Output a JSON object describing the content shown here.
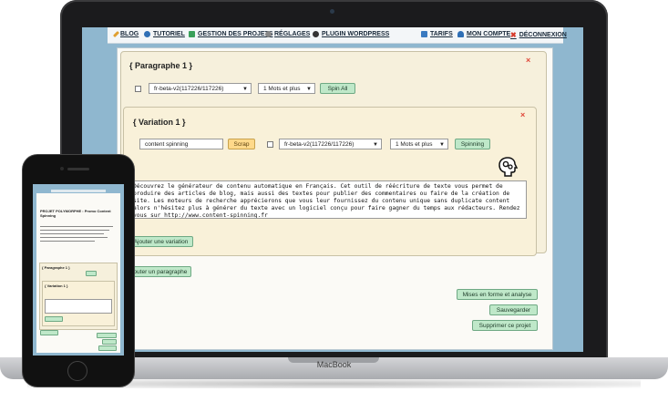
{
  "device": {
    "brand": "MacBook"
  },
  "nav": {
    "items": [
      {
        "label": "BLOG",
        "icon": "pencil-icon",
        "color": "#e0a030"
      },
      {
        "label": "TUTORIEL",
        "icon": "info-icon",
        "color": "#2f6fb5"
      },
      {
        "label": "GESTION DES PROJETS",
        "icon": "plus-icon",
        "color": "#3aa05a"
      },
      {
        "label": "RÉGLAGES",
        "icon": "gear-icon",
        "color": "#666666"
      },
      {
        "label": "PLUGIN WORDPRESS",
        "icon": "wordpress-icon",
        "color": "#333333"
      },
      {
        "label": "TARIFS",
        "icon": "list-icon",
        "color": "#3a7ac0"
      },
      {
        "label": "MON COMPTE",
        "icon": "user-icon",
        "color": "#2f6fb5"
      },
      {
        "label": "DÉCONNEXION",
        "icon": "close-icon",
        "color": "#d63b2c"
      }
    ]
  },
  "paragraph": {
    "title": "{ Paragraphe 1 }",
    "close": "×",
    "language_select": "fr-beta-v2(117226/117226)",
    "words_select": "1 Mots et plus",
    "spin_all_label": "Spin All"
  },
  "variation": {
    "title": "{ Variation 1 }",
    "close": "×",
    "keyword_value": "content spinning",
    "scrap_label": "Scrap",
    "language_select": "fr-beta-v2(117226/117226)",
    "words_select": "1 Mots et plus",
    "spinning_label": "Spinning",
    "text": "Découvrez le générateur de contenu automatique en Français. Cet outil de réécriture de texte vous permet de produire des articles de blog, mais aussi des textes pour publier des commentaires ou faire de la création de site. Les moteurs de recherche apprécierons que vous leur fournissez du contenu unique sans duplicate content alors n'hésitez plus à générer du texte avec un logiciel conçu pour faire gagner du temps aux rédacteurs. Rendez vous sur http://www.content-spinning.fr"
  },
  "actions": {
    "add_variation": "Ajouter une variation",
    "add_paragraph": "Ajouter un paragraphe",
    "format_analyze": "Mises en forme et analyse",
    "save": "Sauvegarder",
    "delete_project": "Supprimer ce projet"
  },
  "phone": {
    "project_title": "PROJET POLYMORPHE : Promo Content Spinning",
    "paragraph_title": "{ Paragraphe 1 }",
    "variation_title": "{ Variation 1 }"
  },
  "colors": {
    "screen_bg": "#8fb7cf",
    "green_button": "#bfe8c9",
    "scrap_button": "#ffd98a",
    "close_red": "#e0483a"
  }
}
